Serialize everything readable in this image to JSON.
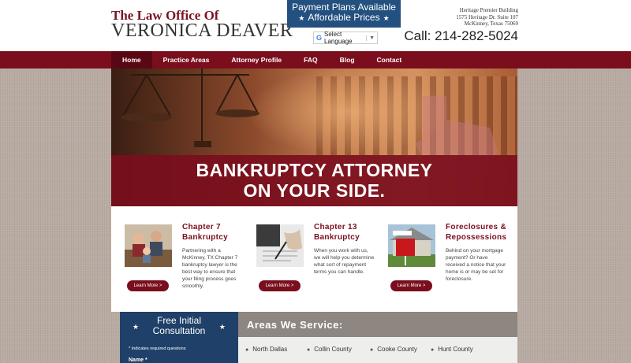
{
  "header": {
    "logo_line1": "The Law Office Of",
    "logo_line2": "VERONICA DEAVER",
    "promo_line1": "Payment Plans Available",
    "promo_line2": "Affordable Prices",
    "translate_label": "Select Language",
    "address_line1": "Heritage Premier Building",
    "address_line2": "1575 Heritage Dr. Suite 107",
    "address_line3": "McKinney, Texas 75069",
    "phone": "Call: 214-282-5024"
  },
  "nav": {
    "items": [
      "Home",
      "Practice Areas",
      "Attorney Profile",
      "FAQ",
      "Blog",
      "Contact"
    ],
    "active": "Home"
  },
  "hero": {
    "line1": "BANKRUPTCY ATTORNEY",
    "line2": "ON YOUR SIDE."
  },
  "features": [
    {
      "title1": "Chapter 7",
      "title2": "Bankruptcy",
      "desc": "Partnering with a McKinney, TX Chapter 7 bankruptcy lawyer is the best way to ensure that your filing process goes smoothly.",
      "button": "Learn More >"
    },
    {
      "title1": "Chapter 13",
      "title2": "Bankruptcy",
      "desc": "When you work with us, we will help you determine what sort of repayment terms you can handle.",
      "button": "Learn More >"
    },
    {
      "title1": "Foreclosures &",
      "title2": "Repossessions",
      "desc": "Behind on your mortgage payment? Or have received a notice that your home is or may be set for foreclosure.",
      "button": "Learn More >"
    }
  ],
  "consult": {
    "title1": "Free Initial",
    "title2": "Consultation",
    "note": "* Indicates required questions",
    "name_label": "Name *"
  },
  "areas": {
    "heading": "Areas We Service:",
    "items": [
      "North Dallas",
      "Collin County",
      "Cooke County",
      "Hunt County"
    ]
  },
  "colors": {
    "brand": "#7a0e1d",
    "navy": "#24507f",
    "band": "#8e8681"
  }
}
